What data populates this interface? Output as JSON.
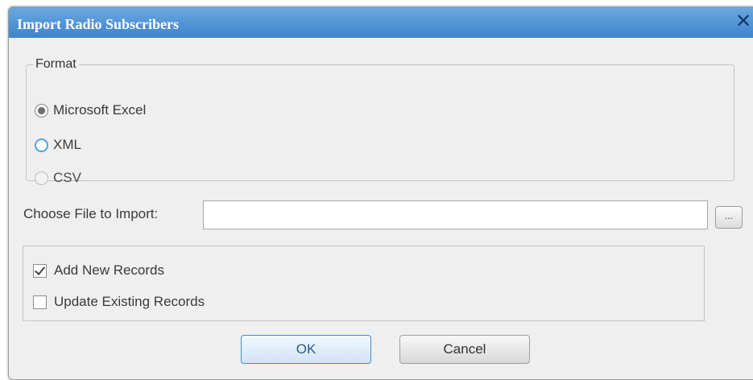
{
  "window": {
    "title": "Import Radio Subscribers",
    "close_icon": "close-icon",
    "close_glyph": "✕"
  },
  "format": {
    "legend": "Format",
    "options": [
      {
        "label": "Microsoft Excel",
        "state": "selected"
      },
      {
        "label": "XML",
        "state": "hover"
      },
      {
        "label": "CSV",
        "state": "disabled"
      }
    ]
  },
  "file": {
    "label": "Choose File to Import:",
    "value": "",
    "browse_label": "..."
  },
  "records": {
    "add_new": {
      "label": "Add New Records",
      "checked": true
    },
    "update_existing": {
      "label": "Update Existing Records",
      "checked": false
    }
  },
  "buttons": {
    "ok": "OK",
    "cancel": "Cancel"
  },
  "colors": {
    "titlebar": "#4a8fd4",
    "accent": "#4aa3e4",
    "background": "#efefef"
  }
}
